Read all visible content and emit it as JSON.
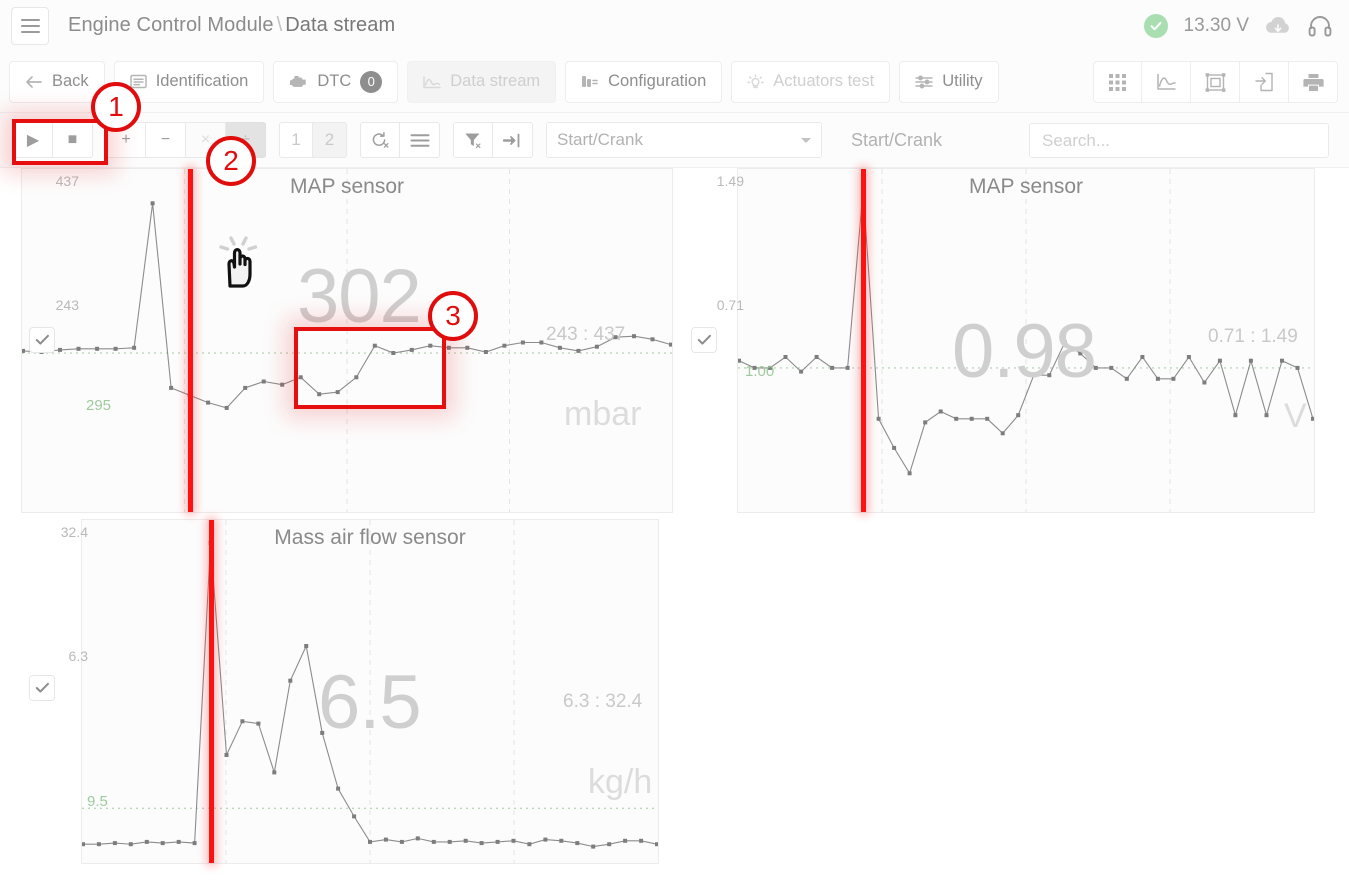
{
  "titlebar": {
    "app_title": "Engine Control Module",
    "separator": "\\",
    "page_title": "Data stream",
    "voltage": "13.30 V",
    "menu_icon": "hamburger-icon",
    "status_icon": "check-circle-icon",
    "cloud_icon": "cloud-download-icon",
    "support_icon": "headset-icon"
  },
  "tabs": [
    {
      "label": "Back",
      "icon": "arrow-left-icon",
      "state": "normal"
    },
    {
      "label": "Identification",
      "icon": "document-icon",
      "state": "normal"
    },
    {
      "label": "DTC",
      "icon": "engine-icon",
      "state": "normal",
      "badge": "0"
    },
    {
      "label": "Data stream",
      "icon": "chart-line-icon",
      "state": "active"
    },
    {
      "label": "Configuration",
      "icon": "sliders-icon",
      "state": "normal"
    },
    {
      "label": "Actuators test",
      "icon": "bulb-icon",
      "state": "muted"
    },
    {
      "label": "Utility",
      "icon": "equalizer-icon",
      "state": "normal"
    }
  ],
  "view_tools": [
    {
      "name": "grid-view-icon"
    },
    {
      "name": "graph-view-icon"
    },
    {
      "name": "fit-screen-icon"
    },
    {
      "name": "export-file-icon"
    },
    {
      "name": "print-icon"
    }
  ],
  "controls": {
    "play_label": "▶",
    "stop_label": "■",
    "plus_label": "+",
    "minus_label": "−",
    "multiply_label": "×",
    "divide_label": "÷",
    "page_1": "1",
    "page_2": "2",
    "clear_icon": "clear-recording-icon",
    "list_icon": "list-menu-icon",
    "filter_icon": "filter-clear-icon",
    "jump_icon": "jump-to-end-icon",
    "dropdown_value": "Start/Crank",
    "status_label": "Start/Crank"
  },
  "search": {
    "value": "",
    "placeholder": "Search..."
  },
  "annotations": [
    {
      "id": "1",
      "label": "1"
    },
    {
      "id": "2",
      "label": "2"
    },
    {
      "id": "3",
      "label": "3"
    }
  ],
  "highlighted_value": "302",
  "chart_data": [
    {
      "type": "line",
      "title": "MAP sensor",
      "unit": "mbar",
      "current_value": "302",
      "range_label": "243 : 437",
      "ylabel": "mbar",
      "yticks": [
        "437",
        "243"
      ],
      "ylim": [
        150,
        460
      ],
      "baseline_label": "295",
      "baseline_value": 295,
      "grid": true,
      "checkbox_checked": true,
      "cursor_x_index": 9,
      "values": [
        297,
        296,
        298,
        299,
        299,
        299,
        300,
        437,
        262,
        255,
        248,
        243,
        262,
        268,
        265,
        272,
        256,
        258,
        272,
        302,
        295,
        298,
        302,
        300,
        300,
        296,
        302,
        305,
        305,
        300,
        297,
        301,
        310,
        311,
        308,
        303
      ],
      "x": [
        0,
        1,
        2,
        3,
        4,
        5,
        6,
        7,
        8,
        9,
        10,
        11,
        12,
        13,
        14,
        15,
        16,
        17,
        18,
        19,
        20,
        21,
        22,
        23,
        24,
        25,
        26,
        27,
        28,
        29,
        30,
        31,
        32,
        33,
        34,
        35
      ]
    },
    {
      "type": "line",
      "title": "MAP sensor",
      "unit": "V",
      "current_value": "0.98",
      "range_label": "0.71 : 1.49",
      "ylabel": "V",
      "yticks": [
        "1.49",
        "0.71"
      ],
      "ylim": [
        0.62,
        1.52
      ],
      "baseline_label": "1.00",
      "baseline_value": 1.0,
      "grid": true,
      "checkbox_checked": true,
      "cursor_x_index": 8,
      "values": [
        1.02,
        1.0,
        1.0,
        1.03,
        0.99,
        1.03,
        1.0,
        1.0,
        1.49,
        0.86,
        0.78,
        0.71,
        0.85,
        0.88,
        0.86,
        0.86,
        0.86,
        0.82,
        0.87,
        0.98,
        0.98,
        1.07,
        1.04,
        1.0,
        1.0,
        0.97,
        1.03,
        0.97,
        0.97,
        1.03,
        0.96,
        1.02,
        0.87,
        1.02,
        0.87,
        1.02,
        1.0,
        0.86
      ],
      "x": [
        0,
        1,
        2,
        3,
        4,
        5,
        6,
        7,
        8,
        9,
        10,
        11,
        12,
        13,
        14,
        15,
        16,
        17,
        18,
        19,
        20,
        21,
        22,
        23,
        24,
        25,
        26,
        27,
        28,
        29,
        30,
        31,
        32,
        33,
        34,
        35,
        36,
        37
      ]
    },
    {
      "type": "line",
      "title": "Mass air flow sensor",
      "unit": "kg/h",
      "current_value": "6.5",
      "range_label": "6.3 : 32.4",
      "ylabel": "kg/h",
      "yticks": [
        "32.4",
        "6.3"
      ],
      "ylim": [
        5.3,
        33.5
      ],
      "baseline_label": "9.5",
      "baseline_value": 9.5,
      "grid": true,
      "checkbox_checked": true,
      "cursor_x_index": 8,
      "values": [
        6.4,
        6.4,
        6.5,
        6.4,
        6.6,
        6.5,
        6.6,
        6.5,
        32.4,
        14.1,
        17.0,
        16.8,
        12.6,
        20.5,
        23.5,
        16.0,
        11.2,
        8.8,
        6.6,
        6.8,
        6.6,
        6.9,
        6.6,
        6.6,
        6.7,
        6.5,
        6.6,
        6.7,
        6.4,
        6.8,
        6.7,
        6.5,
        6.2,
        6.4,
        6.7,
        6.7,
        6.4
      ],
      "x": [
        0,
        1,
        2,
        3,
        4,
        5,
        6,
        7,
        8,
        9,
        10,
        11,
        12,
        13,
        14,
        15,
        16,
        17,
        18,
        19,
        20,
        21,
        22,
        23,
        24,
        25,
        26,
        27,
        28,
        29,
        30,
        31,
        32,
        33,
        34,
        35,
        36
      ]
    }
  ],
  "colors": {
    "accent_red": "#e60e0e",
    "cursor_red": "#fd1111",
    "ok_green": "#a9dfb0",
    "baseline_green": "#9ecb9e",
    "line_gray": "#8c8c8c",
    "text_gray": "#8a8a8a"
  }
}
